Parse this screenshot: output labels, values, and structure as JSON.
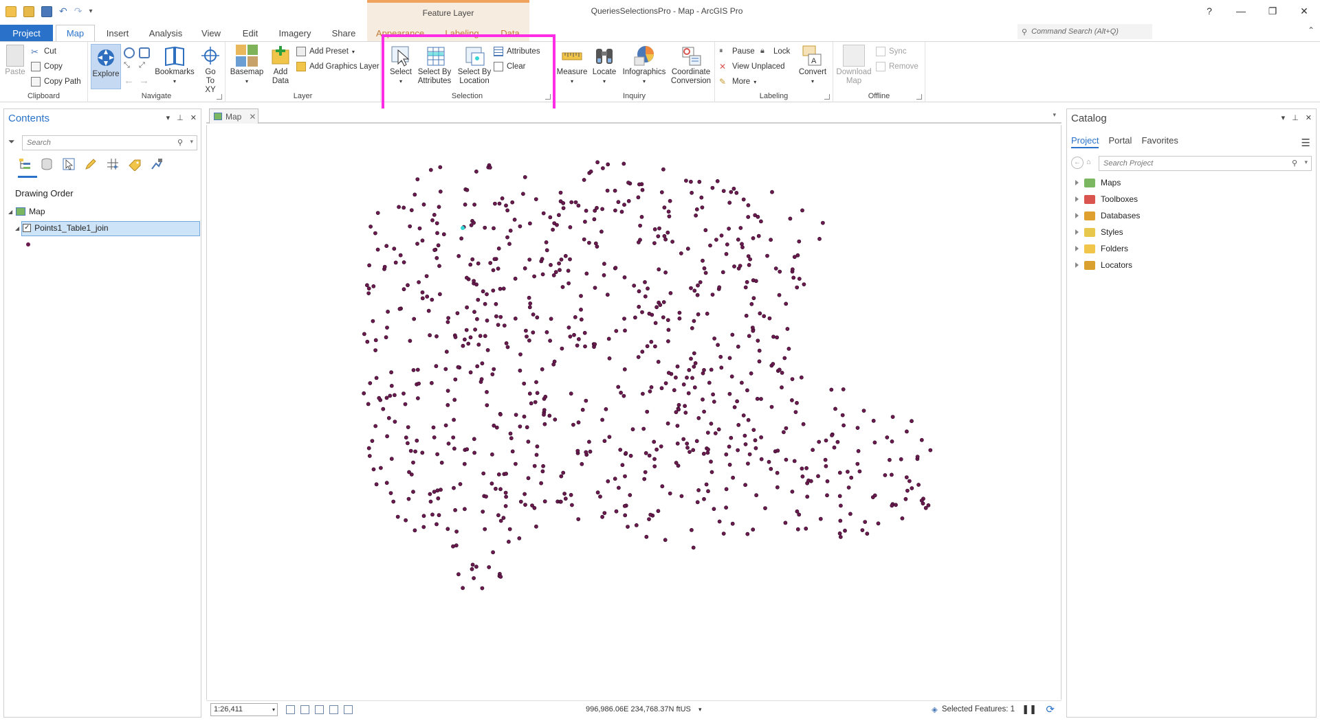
{
  "app": {
    "title": "QueriesSelectionsPro - Map - ArcGIS Pro",
    "context_tab_group": "Feature Layer",
    "window_controls": [
      "?",
      "—",
      "❐",
      "✕"
    ]
  },
  "tabs": {
    "project": "Project",
    "items": [
      "Map",
      "Insert",
      "Analysis",
      "View",
      "Edit",
      "Imagery",
      "Share",
      "Appearance",
      "Labeling",
      "Data"
    ],
    "active": "Map"
  },
  "command_search": {
    "placeholder": "Command Search (Alt+Q)"
  },
  "ribbon": {
    "clipboard": {
      "label": "Clipboard",
      "paste": "Paste",
      "cut": "Cut",
      "copy": "Copy",
      "copy_path": "Copy Path"
    },
    "navigate": {
      "label": "Navigate",
      "explore": "Explore",
      "bookmarks": "Bookmarks",
      "go_to_xy": "Go To XY"
    },
    "layer": {
      "label": "Layer",
      "basemap": "Basemap",
      "add_data": "Add Data",
      "add_preset": "Add Preset",
      "add_graphics_layer": "Add Graphics Layer"
    },
    "selection": {
      "label": "Selection",
      "select": "Select",
      "select_by_attributes": "Select By Attributes",
      "select_by_location": "Select By Location",
      "attributes": "Attributes",
      "clear": "Clear"
    },
    "inquiry": {
      "label": "Inquiry",
      "measure": "Measure",
      "locate": "Locate",
      "infographics": "Infographics",
      "coordinate_conversion": "Coordinate Conversion"
    },
    "labeling": {
      "label": "Labeling",
      "pause": "Pause",
      "lock": "Lock",
      "view_unplaced": "View Unplaced",
      "more": "More",
      "convert": "Convert"
    },
    "offline": {
      "label": "Offline",
      "download_map": "Download Map",
      "sync": "Sync",
      "remove": "Remove"
    }
  },
  "contents": {
    "title": "Contents",
    "search_placeholder": "Search",
    "section": "Drawing Order",
    "map_node": "Map",
    "layer": {
      "name": "Points1_Table1_join",
      "checked": true
    }
  },
  "map_view": {
    "tab_label": "Map",
    "scale": "1:26,411",
    "coordinates": "996,986.06E 234,768.37N ftUS",
    "selected_features": "Selected Features: 1",
    "point_color": "#6b1a4f",
    "selected_point_color": "#35d6d6"
  },
  "catalog": {
    "title": "Catalog",
    "tabs": [
      "Project",
      "Portal",
      "Favorites"
    ],
    "active_tab": "Project",
    "search_placeholder": "Search Project",
    "items": [
      {
        "label": "Maps",
        "color": "#7bb661"
      },
      {
        "label": "Toolboxes",
        "color": "#d9534f"
      },
      {
        "label": "Databases",
        "color": "#e0a030"
      },
      {
        "label": "Styles",
        "color": "#e7c84d"
      },
      {
        "label": "Folders",
        "color": "#f1c54a"
      },
      {
        "label": "Locators",
        "color": "#d9a030"
      }
    ]
  },
  "accent": "#2a72c9",
  "highlight_color": "#ff2ce6"
}
